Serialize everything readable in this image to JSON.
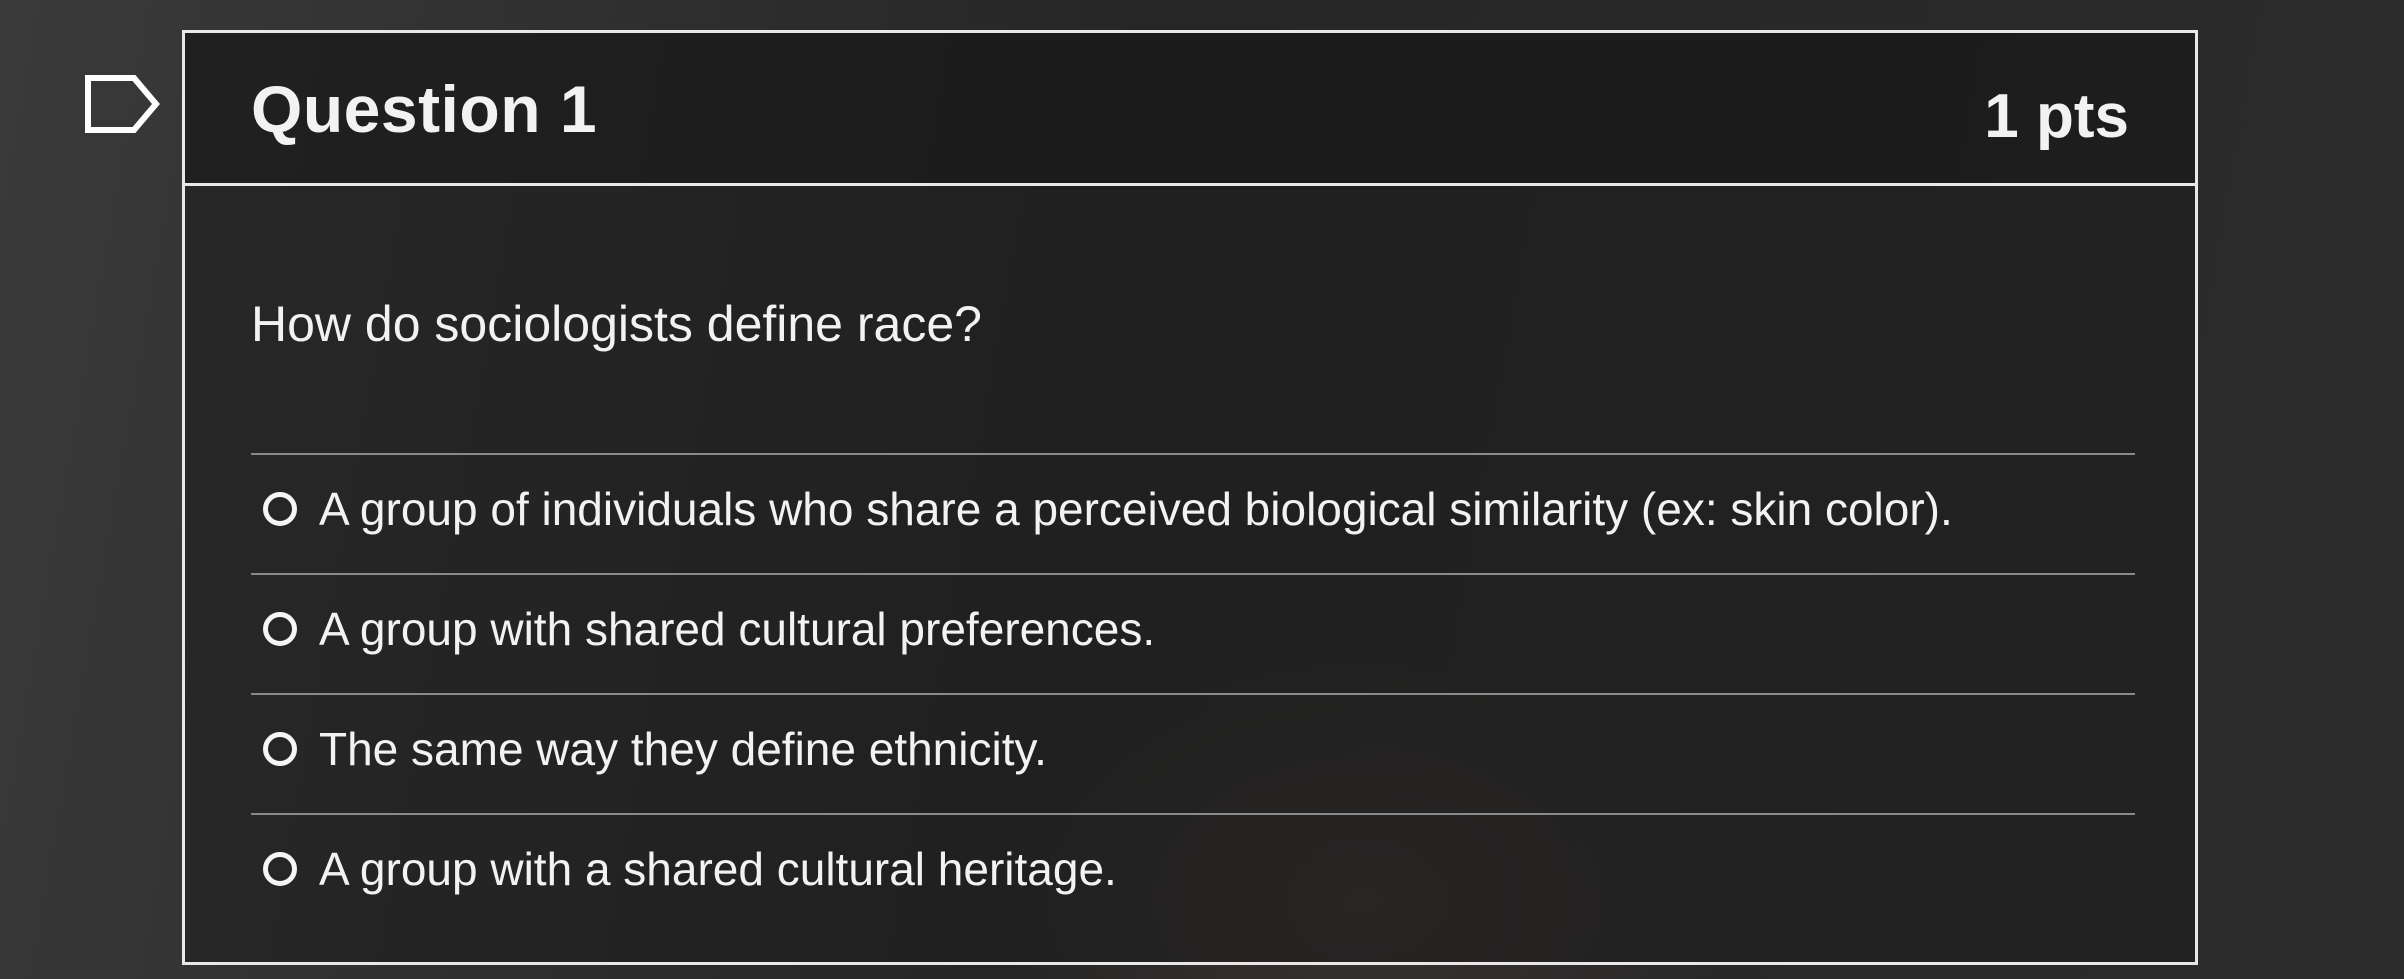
{
  "question": {
    "title": "Question 1",
    "points": "1 pts",
    "prompt": "How do sociologists define race?",
    "answers": [
      "A group of individuals who share a perceived biological similarity (ex: skin color).",
      "A group with shared cultural preferences.",
      "The same way they define ethnicity.",
      "A group with a shared cultural heritage."
    ]
  },
  "colors": {
    "background": "#2a2a2a",
    "border": "#e8e8e8",
    "text": "#f2f2f2"
  },
  "icons": {
    "flag": "flag-outline-icon",
    "radio": "radio-unselected-icon"
  }
}
